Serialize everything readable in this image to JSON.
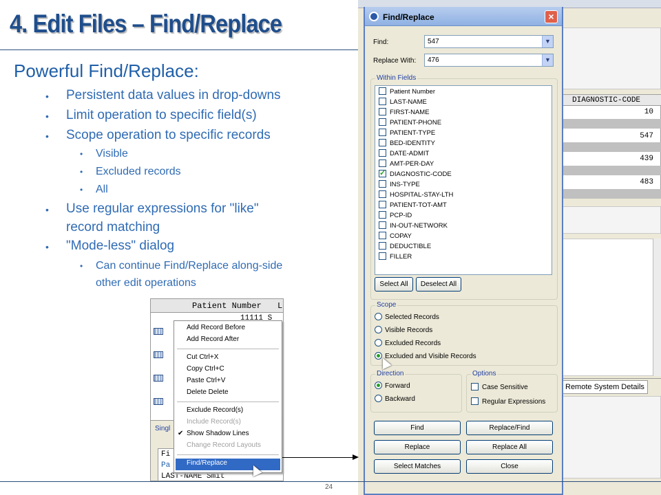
{
  "slide": {
    "title": "4. Edit Files – Find/Replace",
    "subhead": "Powerful Find/Replace:",
    "bullets": [
      "Persistent data values in drop-downs",
      "Limit operation to specific field(s)",
      "Scope operation to specific records",
      "Visible",
      "Excluded records",
      "All",
      "Use regular expressions for \"like\"",
      "record matching",
      "\"Mode-less\" dialog",
      "Can continue Find/Replace along-side",
      "other edit operations"
    ],
    "page_number": "24"
  },
  "background_app": {
    "grid_header": "DIAGNOSTIC-CODE",
    "grid_values": [
      "10",
      "547",
      "439",
      "483"
    ],
    "tab_label": "Remote System Details"
  },
  "dialog": {
    "title": "Find/Replace",
    "find_label": "Find:",
    "find_value": "547",
    "replace_label": "Replace With:",
    "replace_value": "476",
    "within_fields_label": "Within Fields",
    "fields": [
      {
        "name": "Patient Number",
        "checked": false
      },
      {
        "name": "LAST-NAME",
        "checked": false
      },
      {
        "name": "FIRST-NAME",
        "checked": false
      },
      {
        "name": "PATIENT-PHONE",
        "checked": false
      },
      {
        "name": "PATIENT-TYPE",
        "checked": false
      },
      {
        "name": "BED-IDENTITY",
        "checked": false
      },
      {
        "name": "DATE-ADMIT",
        "checked": false
      },
      {
        "name": "AMT-PER-DAY",
        "checked": false
      },
      {
        "name": "DIAGNOSTIC-CODE",
        "checked": true
      },
      {
        "name": "INS-TYPE",
        "checked": false
      },
      {
        "name": "HOSPITAL-STAY-LTH",
        "checked": false
      },
      {
        "name": "PATIENT-TOT-AMT",
        "checked": false
      },
      {
        "name": "PCP-ID",
        "checked": false
      },
      {
        "name": "IN-OUT-NETWORK",
        "checked": false
      },
      {
        "name": "COPAY",
        "checked": false
      },
      {
        "name": "DEDUCTIBLE",
        "checked": false
      },
      {
        "name": "FILLER",
        "checked": false
      }
    ],
    "select_all": "Select All",
    "deselect_all": "Deselect All",
    "scope_label": "Scope",
    "scope_options": [
      "Selected Records",
      "Visible Records",
      "Excluded Records",
      "Excluded and Visible Records"
    ],
    "scope_selected": 3,
    "direction_label": "Direction",
    "direction_options": [
      "Forward",
      "Backward"
    ],
    "direction_selected": 0,
    "options_label": "Options",
    "case_sensitive": "Case Sensitive",
    "regular_expressions": "Regular Expressions",
    "buttons": {
      "find": "Find",
      "replace_find": "Replace/Find",
      "replace": "Replace",
      "replace_all": "Replace All",
      "select_matches": "Select Matches",
      "close": "Close"
    },
    "close_glyph": "×"
  },
  "context_shot": {
    "header_col1": "Patient Number",
    "header_col2": "L",
    "row_value": "11111 S",
    "tab_label": "Singl",
    "inner_lines": [
      "Fi",
      "Pa",
      "LAST-NAME    Smit"
    ],
    "menu_items": [
      {
        "label": "Add Record Before",
        "disabled": false
      },
      {
        "label": "Add Record After",
        "disabled": false
      },
      {
        "label": "Cut  Ctrl+X",
        "disabled": false
      },
      {
        "label": "Copy  Ctrl+C",
        "disabled": false
      },
      {
        "label": "Paste  Ctrl+V",
        "disabled": false
      },
      {
        "label": "Delete  Delete",
        "disabled": false
      },
      {
        "label": "Exclude Record(s)",
        "disabled": false
      },
      {
        "label": "Include Record(s)",
        "disabled": true
      },
      {
        "label": "Show Shadow Lines",
        "disabled": false
      },
      {
        "label": "Change Record Layouts",
        "disabled": true
      },
      {
        "label": "Find/Replace",
        "disabled": false
      }
    ]
  }
}
